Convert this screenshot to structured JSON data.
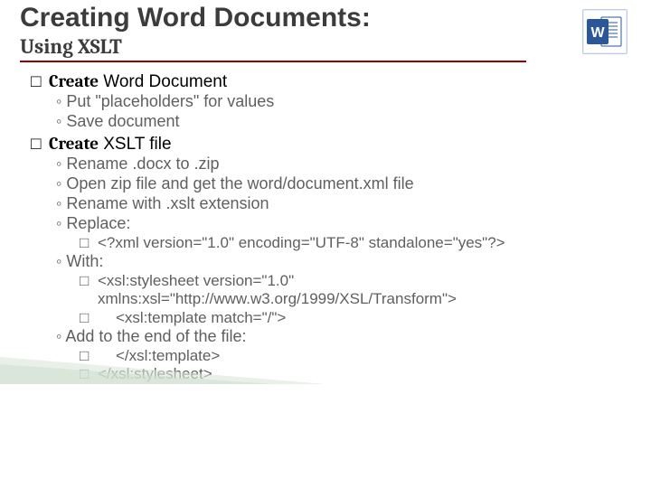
{
  "title": "Creating Word Documents:",
  "subtitle": "Using XSLT",
  "icon_label": "Word",
  "sections": [
    {
      "heading_prefix": "Create",
      "heading_rest": " Word Document",
      "subs": [
        {
          "text": "Put \"placeholders\" for values"
        },
        {
          "text": "Save document"
        }
      ]
    },
    {
      "heading_prefix": "Create",
      "heading_rest": " XSLT file",
      "subs": [
        {
          "text": "Rename .docx to .zip"
        },
        {
          "text": "Open zip file and get the word/document.xml file"
        },
        {
          "text": "Rename with .xslt extension"
        },
        {
          "text": "Replace:",
          "code": [
            {
              "indent": false,
              "text": "<?xml version=\"1.0\" encoding=\"UTF-8\" standalone=\"yes\"?>"
            }
          ]
        },
        {
          "text": "With:",
          "code": [
            {
              "indent": false,
              "text": "<xsl:stylesheet version=\"1.0\""
            },
            {
              "indent": false,
              "nobox": true,
              "text": "xmlns:xsl=\"http://www.w3.org/1999/XSL/Transform\">"
            },
            {
              "indent": true,
              "text": "<xsl:template match=\"/\">"
            }
          ]
        },
        {
          "text": "Add to the end of the file:",
          "code": [
            {
              "indent": true,
              "text": "</xsl:template>"
            },
            {
              "indent": false,
              "text": "</xsl:stylesheet>"
            }
          ]
        }
      ]
    }
  ]
}
